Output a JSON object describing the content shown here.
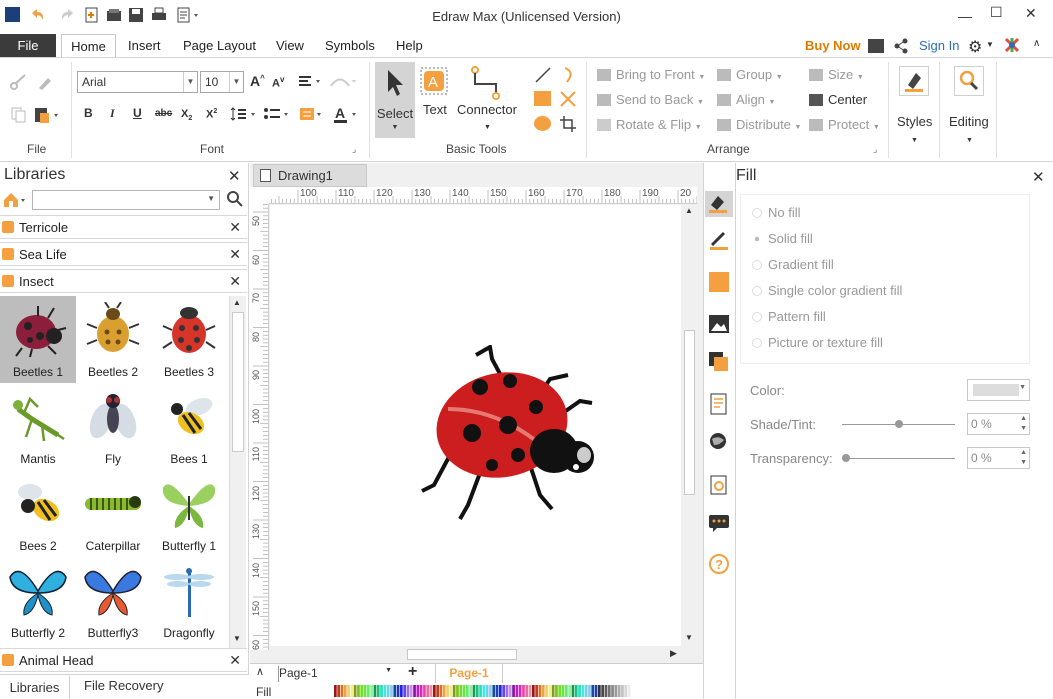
{
  "app": {
    "title": "Edraw Max (Unlicensed Version)"
  },
  "window_controls": {
    "minimize": "—",
    "maximize": "☐",
    "close": "✕"
  },
  "menu": {
    "file": "File",
    "tabs": [
      "Home",
      "Insert",
      "Page Layout",
      "View",
      "Symbols",
      "Help"
    ],
    "buy_now": "Buy Now",
    "sign_in": "Sign In"
  },
  "ribbon": {
    "groups": {
      "file": "File",
      "font": "Font",
      "basic_tools": "Basic Tools",
      "arrange": "Arrange"
    },
    "font_name": "Arial",
    "font_size": "10",
    "tools": {
      "select": "Select",
      "text": "Text",
      "connector": "Connector"
    },
    "arrange": {
      "bring_to_front": "Bring to Front",
      "send_to_back": "Send to Back",
      "rotate_flip": "Rotate & Flip",
      "group": "Group",
      "align": "Align",
      "distribute": "Distribute",
      "size": "Size",
      "center": "Center",
      "protect": "Protect"
    },
    "styles": "Styles",
    "editing": "Editing"
  },
  "libraries": {
    "title": "Libraries",
    "categories": [
      "Terricole",
      "Sea Life",
      "Insect"
    ],
    "bottom_category": "Animal Head",
    "shapes": [
      {
        "label": "Beetles 1"
      },
      {
        "label": "Beetles 2"
      },
      {
        "label": "Beetles 3"
      },
      {
        "label": "Mantis"
      },
      {
        "label": "Fly"
      },
      {
        "label": "Bees 1"
      },
      {
        "label": "Bees 2"
      },
      {
        "label": "Caterpillar"
      },
      {
        "label": "Butterfly 1"
      },
      {
        "label": "Butterfly 2"
      },
      {
        "label": "Butterfly3"
      },
      {
        "label": "Dragonfly"
      }
    ],
    "bottom_tabs": [
      "Libraries",
      "File Recovery"
    ]
  },
  "canvas": {
    "doc_tab": "Drawing1",
    "ruler_h": [
      "100",
      "110",
      "120",
      "130",
      "140",
      "150",
      "160",
      "170",
      "180",
      "190",
      "20"
    ],
    "ruler_v": [
      "50",
      "60",
      "70",
      "80",
      "90",
      "100",
      "110",
      "120",
      "130",
      "140",
      "150",
      "60"
    ],
    "page_select": "Page-1",
    "page_tab": "Page-1",
    "fill_label": "Fill"
  },
  "fill_panel": {
    "title": "Fill",
    "options": [
      "No fill",
      "Solid fill",
      "Gradient fill",
      "Single color gradient fill",
      "Pattern fill",
      "Picture or texture fill"
    ],
    "color_label": "Color:",
    "shade_label": "Shade/Tint:",
    "shade_value": "0 %",
    "transparency_label": "Transparency:",
    "transparency_value": "0 %"
  },
  "colors": {
    "accent": "#f5a040",
    "filetab": "#3b3b3b",
    "link": "#2a6ebb",
    "buy": "#e07b00"
  }
}
